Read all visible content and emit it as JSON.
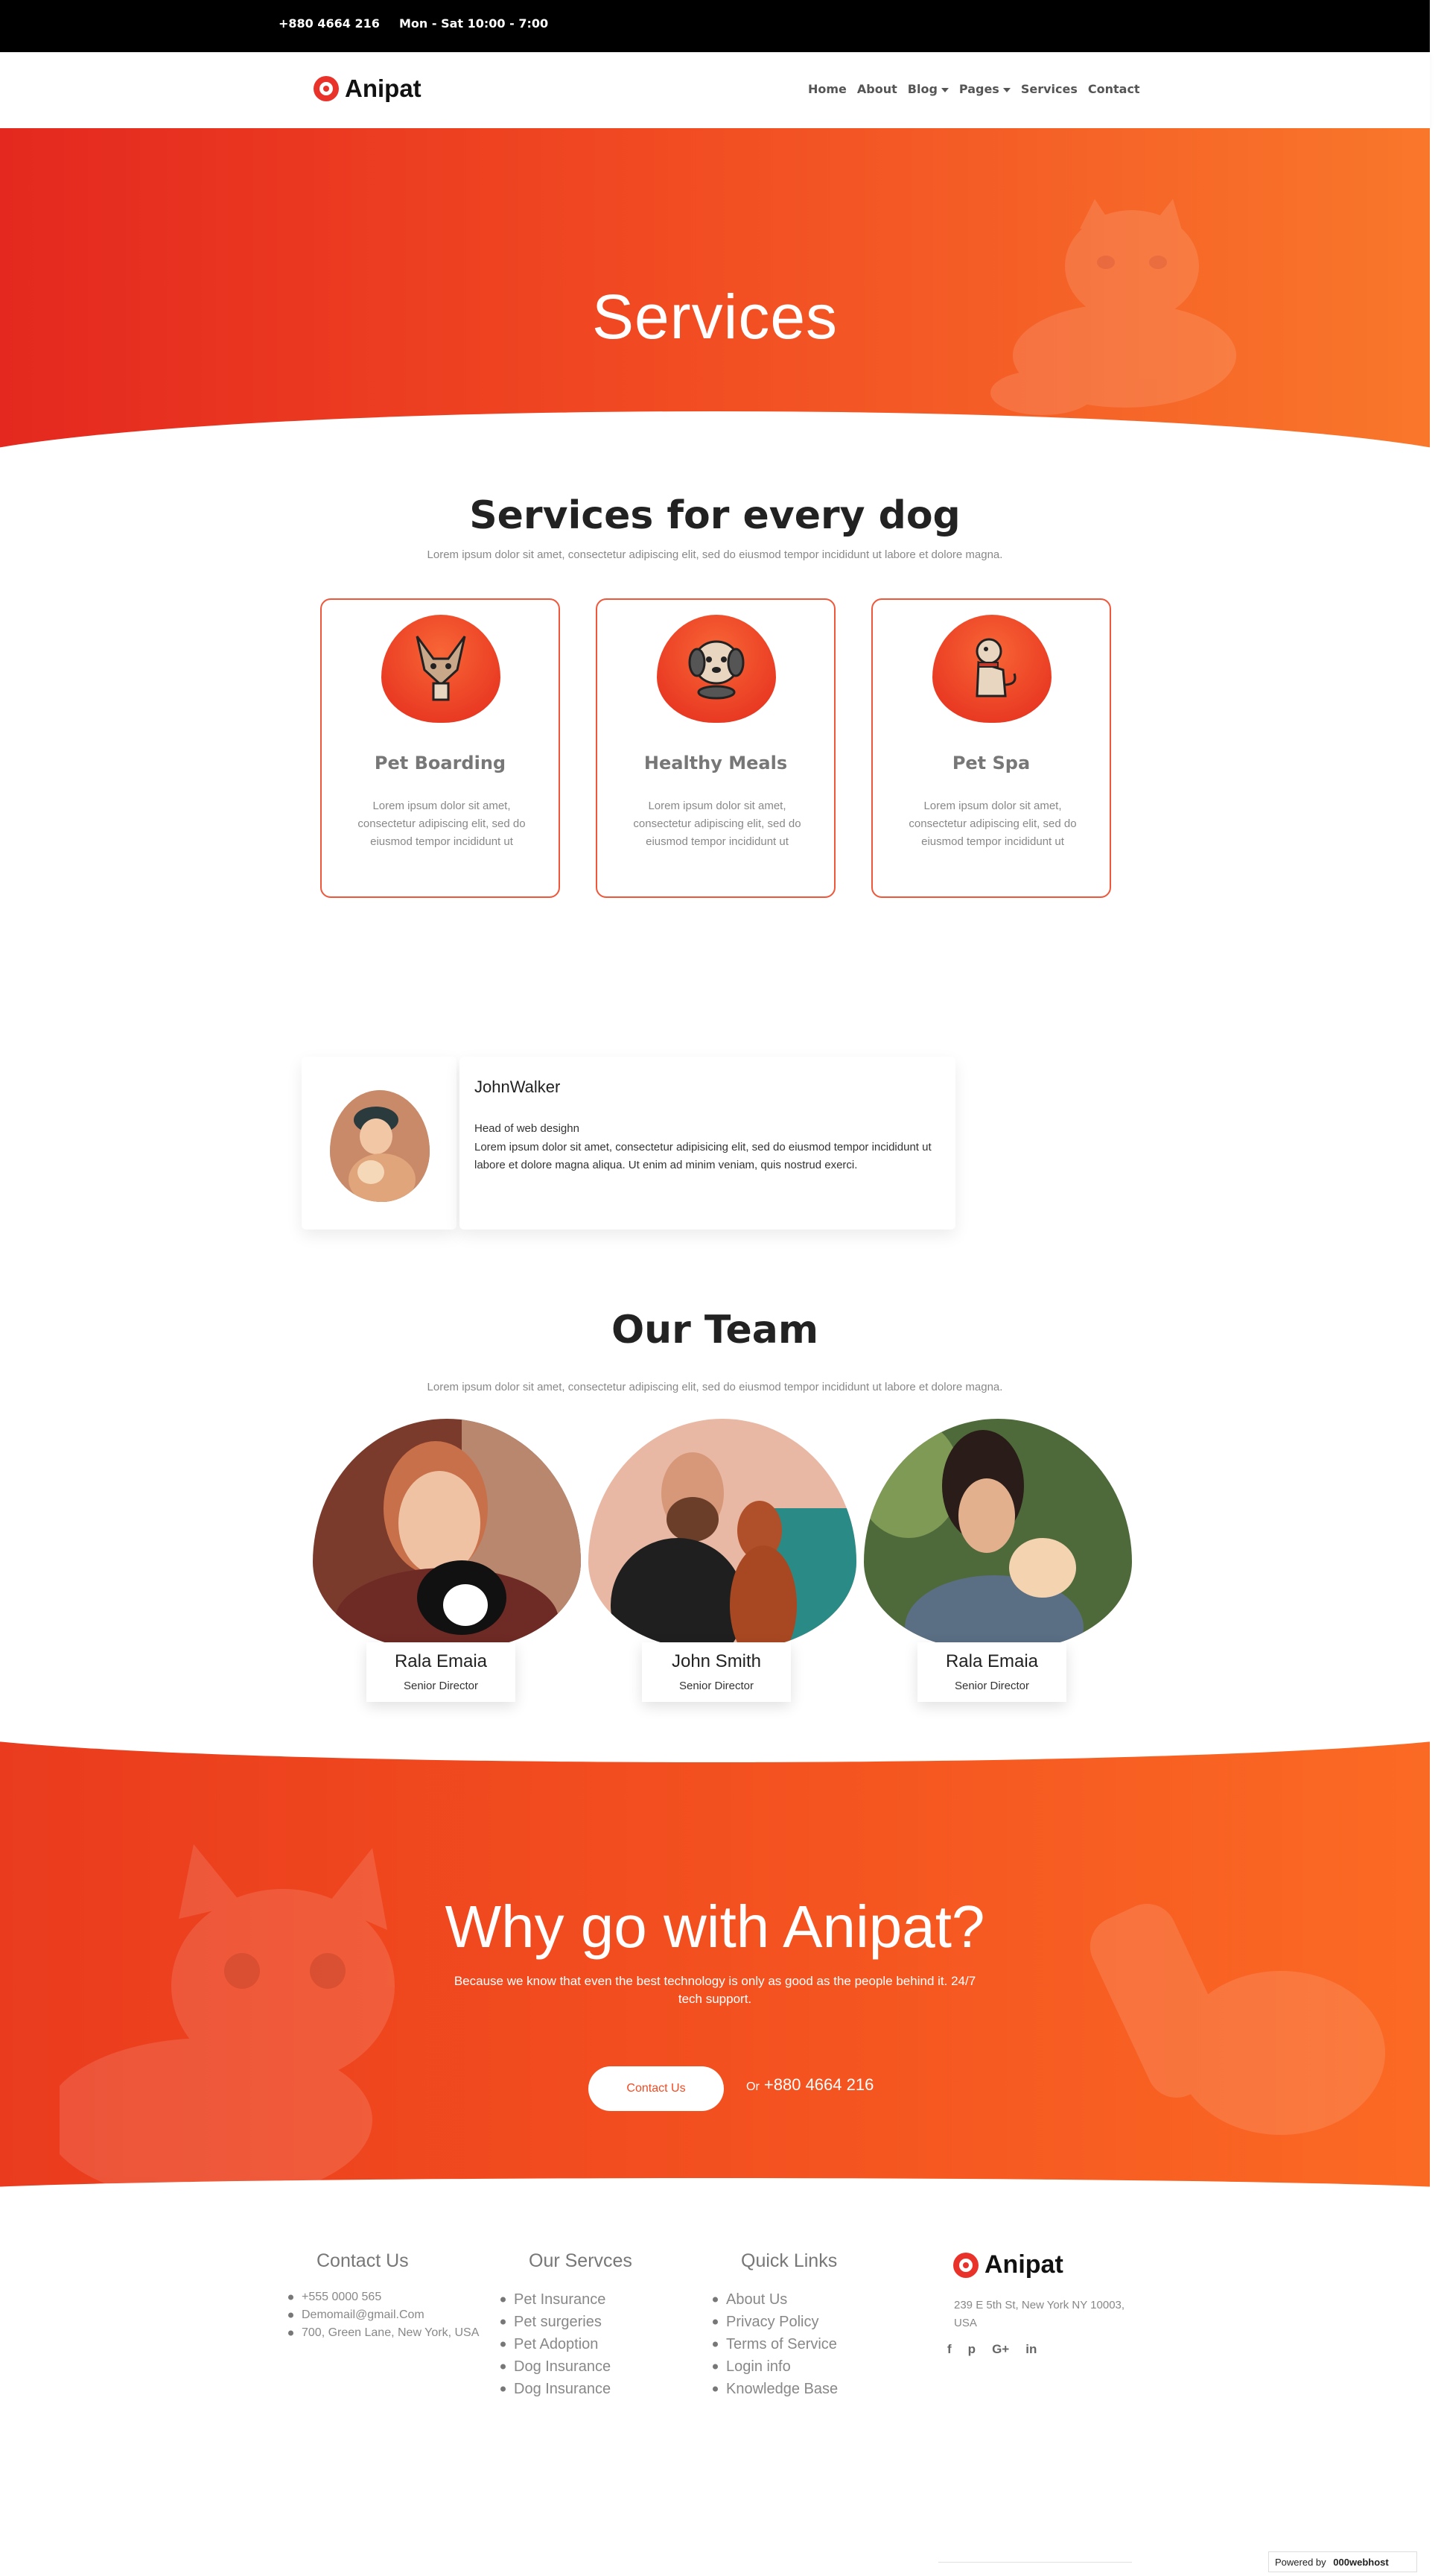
{
  "topbar": {
    "phone": "+880 4664 216",
    "hours": "Mon - Sat 10:00 - 7:00"
  },
  "brand": {
    "name": "Anipat",
    "accent": "#f14a22",
    "accent_dark": "#e4281f"
  },
  "nav": {
    "items": [
      "Home",
      "About",
      "Blog",
      "Pages",
      "Services",
      "Contact"
    ]
  },
  "hero": {
    "title": "Services"
  },
  "services": {
    "title": "Services for every dog",
    "subtitle": "Lorem ipsum dolor sit amet, consectetur adipiscing elit, sed do eiusmod tempor incididunt ut labore et dolore magna.",
    "cards": [
      {
        "icon": "dog-icon",
        "title": "Pet Boarding",
        "text": "Lorem ipsum dolor sit amet, consectetur adipiscing elit, sed do eiusmod tempor incididunt ut"
      },
      {
        "icon": "dog-food-icon",
        "title": "Healthy Meals",
        "text": "Lorem ipsum dolor sit amet, consectetur adipiscing elit, sed do eiusmod tempor incididunt ut"
      },
      {
        "icon": "sitting-dog-icon",
        "title": "Pet Spa",
        "text": "Lorem ipsum dolor sit amet, consectetur adipiscing elit, sed do eiusmod tempor incididunt ut"
      }
    ]
  },
  "testimonial": {
    "name": "JohnWalker",
    "role": "Head of web desighn",
    "text": "Lorem ipsum dolor sit amet, consectetur adipisicing elit, sed do eiusmod tempor incididunt ut labore et dolore magna aliqua. Ut enim ad minim veniam, quis nostrud exerci."
  },
  "team": {
    "title": "Our Team",
    "subtitle": "Lorem ipsum dolor sit amet, consectetur adipiscing elit, sed do eiusmod tempor incididunt ut labore et dolore magna.",
    "members": [
      {
        "name": "Rala Emaia",
        "role": "Senior Director"
      },
      {
        "name": "John Smith",
        "role": "Senior Director"
      },
      {
        "name": "Rala Emaia",
        "role": "Senior Director"
      }
    ]
  },
  "why": {
    "title": "Why go with Anipat?",
    "subtitle": "Because we know that even the best technology is only as good as the people behind it. 24/7 tech support.",
    "button": "Contact Us",
    "or_label": "Or",
    "phone": "+880 4664 216"
  },
  "footer": {
    "contact": {
      "title": "Contact Us",
      "items": [
        "+555 0000 565",
        "Demomail@gmail.Com",
        "700, Green Lane, New York, USA"
      ]
    },
    "services": {
      "title": "Our Servces",
      "items": [
        "Pet Insurance",
        "Pet surgeries",
        "Pet Adoption",
        "Dog Insurance",
        "Dog Insurance"
      ]
    },
    "links": {
      "title": "Quick Links",
      "items": [
        "About Us",
        "Privacy Policy",
        "Terms of Service",
        "Login info",
        "Knowledge Base"
      ]
    },
    "address": "239 E 5th St, New York NY 10003, USA",
    "social": [
      "f",
      "p",
      "G+",
      "in"
    ]
  },
  "powered": {
    "label": "Powered by",
    "host": "000webhost"
  }
}
